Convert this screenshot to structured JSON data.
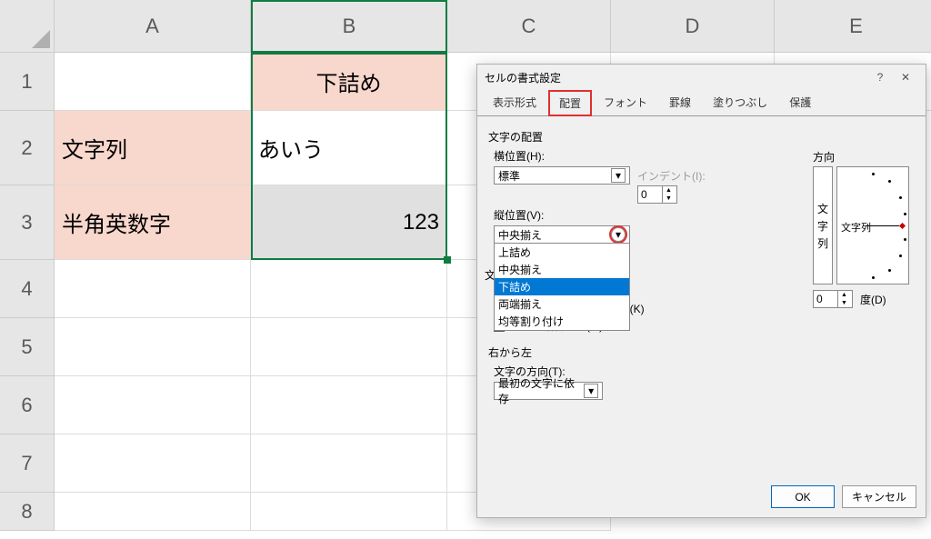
{
  "columns": [
    "A",
    "B",
    "C",
    "D",
    "E"
  ],
  "rows": [
    "1",
    "2",
    "3",
    "4",
    "5",
    "6",
    "7",
    "8"
  ],
  "cells": {
    "B1": "下詰め",
    "A2": "文字列",
    "B2": "あいう",
    "A3": "半角英数字",
    "B3": "123"
  },
  "dialog": {
    "title": "セルの書式設定",
    "help": "?",
    "close": "✕",
    "tabs": {
      "t0": "表示形式",
      "t1": "配置",
      "t2": "フォント",
      "t3": "罫線",
      "t4": "塗りつぶし",
      "t5": "保護"
    },
    "sections": {
      "text_align": "文字の配置",
      "horiz_label": "横位置(H):",
      "horiz_value": "標準",
      "indent_label": "インデント(I):",
      "indent_value": "0",
      "vert_label": "縦位置(V):",
      "vert_value": "中央揃え",
      "vert_options": {
        "o0": "上詰め",
        "o1": "中央揃え",
        "o2": "下詰め",
        "o3": "両端揃え",
        "o4": "均等割り付け"
      },
      "text_control_hidden_label": "文",
      "shrink": "縮小して全体を表示する(K)",
      "merge": "セルを結合する(M)",
      "rtl": "右から左",
      "textdir_label": "文字の方向(T):",
      "textdir_value": "最初の文字に依存",
      "orient": "方向",
      "orient_vtext": "文字列",
      "orient_htext": "文字列",
      "deg_value": "0",
      "deg_label": "度(D)"
    },
    "buttons": {
      "ok": "OK",
      "cancel": "キャンセル"
    }
  }
}
